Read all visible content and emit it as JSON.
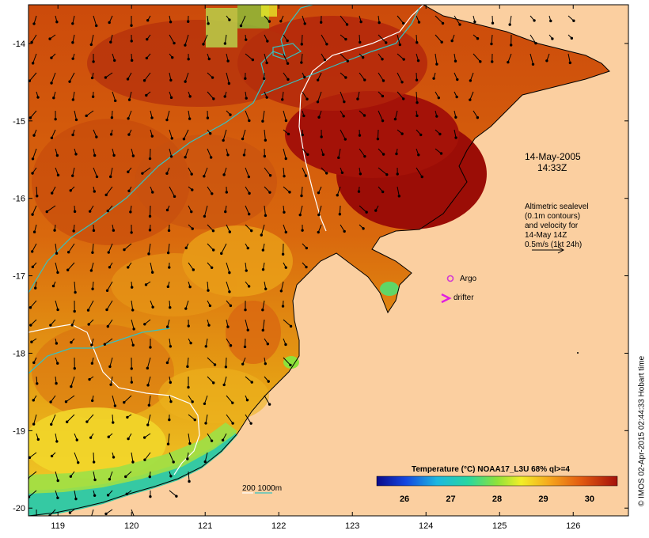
{
  "map": {
    "timestamp_date": "14-May-2005",
    "timestamp_time": "14:33Z",
    "altimetry_note": [
      "Altimetric sealevel",
      "(0.1m contours)",
      "and velocity for",
      "14-May 14Z",
      "0.5m/s (1kt 24h)"
    ],
    "legend_argo": "Argo",
    "legend_drifter": "drifter",
    "scale_label": "200  1000m",
    "colorbar_title": "Temperature (°C) NOAA17_L3U 68% ql>=4",
    "colorbar_ticks": [
      "26",
      "27",
      "28",
      "29",
      "30"
    ],
    "colorbar_range": [
      25.4,
      30.6
    ],
    "x_ticks": [
      "119",
      "120",
      "121",
      "122",
      "123",
      "124",
      "125",
      "126"
    ],
    "y_ticks": [
      "-14",
      "-15",
      "-16",
      "-17",
      "-18",
      "-19",
      "-20"
    ],
    "lon_range": [
      118.6,
      126.75
    ],
    "lat_range": [
      -13.5,
      -20.1
    ],
    "credit": "© IMOS 02-Apr-2015 02:44:33 Hobart time",
    "colors": {
      "land": "#fbcfa0",
      "sst_hot": "#9b0d06",
      "sst_warm": "#d45a0c",
      "sst_mid": "#e8a316",
      "sst_cool": "#f6f02a",
      "sst_cold": "#1ec7a6",
      "contour_200": "#ffffff",
      "contour_1000": "#33c3c3",
      "argo": "#d23bd2",
      "drifter": "#e01ee0"
    },
    "icons": {
      "argo": "circle-marker",
      "drifter": "chevron-marker"
    }
  }
}
